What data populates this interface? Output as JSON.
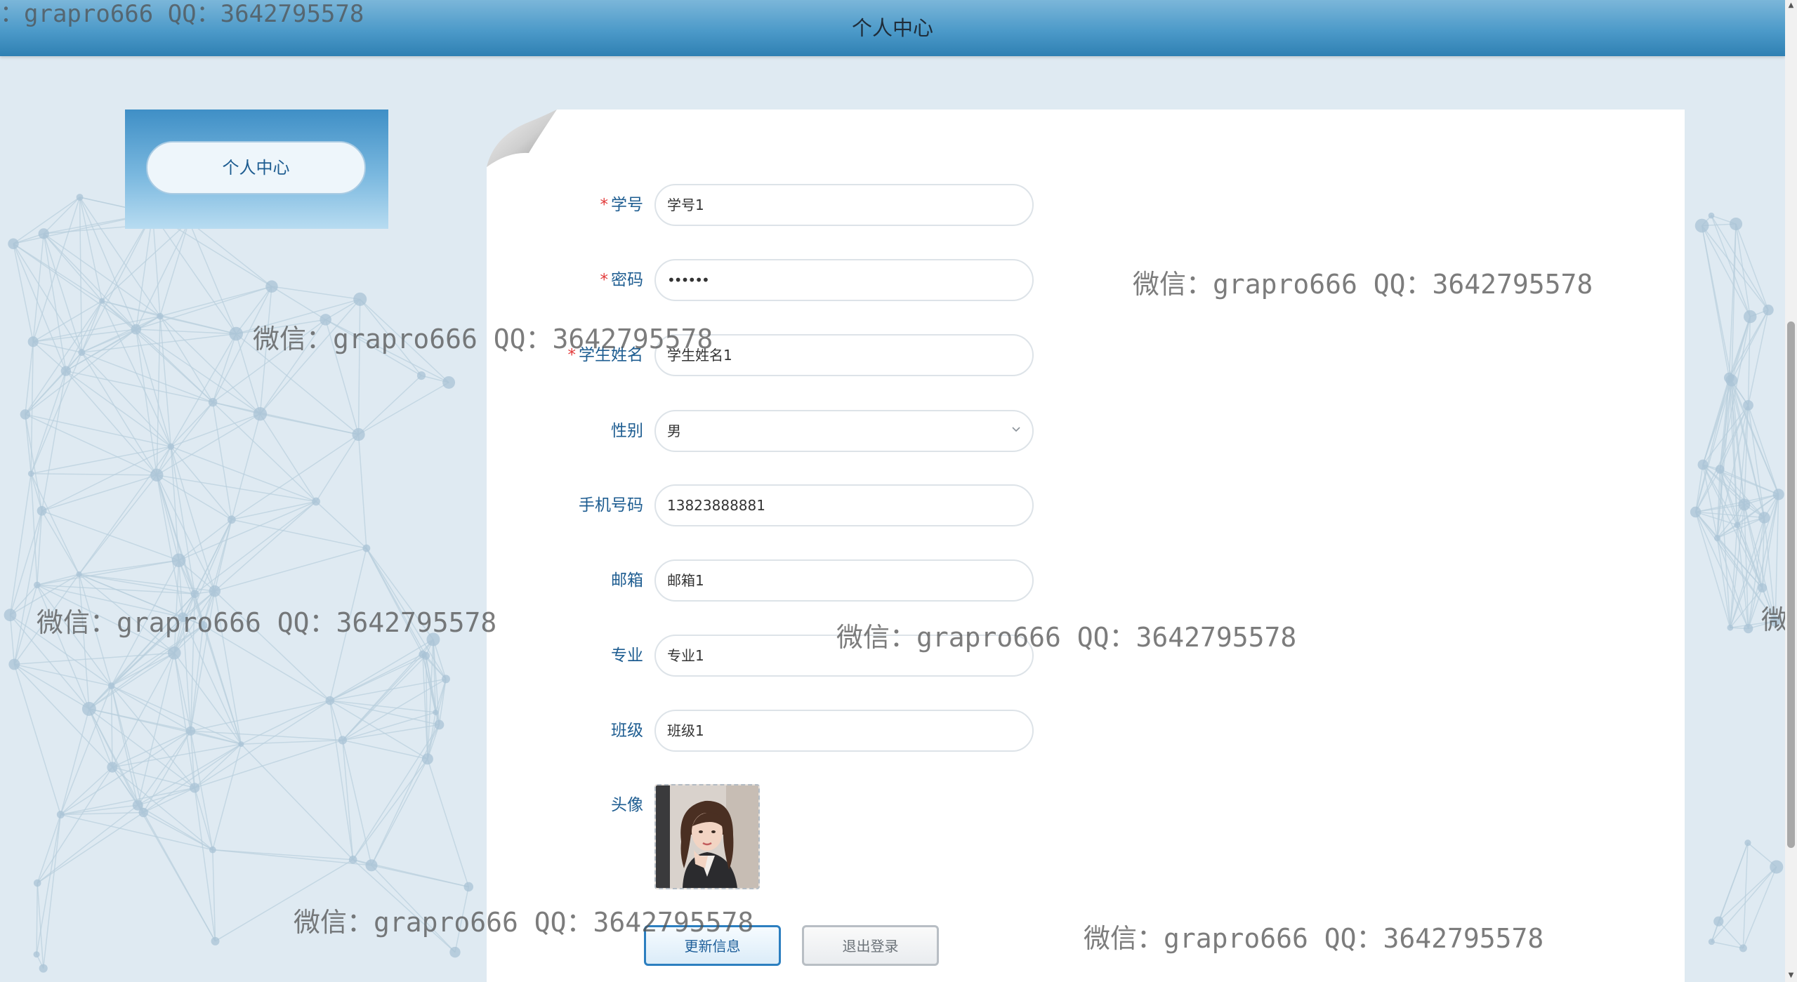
{
  "header": {
    "title": "个人中心"
  },
  "sidebar": {
    "button_label": "个人中心"
  },
  "form": {
    "fields": [
      {
        "label": "学号",
        "required": true,
        "value": "学号1"
      },
      {
        "label": "密码",
        "required": true,
        "value": "••••••"
      },
      {
        "label": "学生姓名",
        "required": true,
        "value": "学生姓名1"
      },
      {
        "label": "性别",
        "required": false,
        "value": "男"
      },
      {
        "label": "手机号码",
        "required": false,
        "value": "13823888881"
      },
      {
        "label": "邮箱",
        "required": false,
        "value": "邮箱1"
      },
      {
        "label": "专业",
        "required": false,
        "value": "专业1"
      },
      {
        "label": "班级",
        "required": false,
        "value": "班级1"
      },
      {
        "label": "头像",
        "required": false
      }
    ],
    "required_mark": "*"
  },
  "buttons": {
    "update": "更新信息",
    "logout": "退出登录"
  },
  "watermark_text": "微信：grapro666 QQ：3642795578",
  "watermark_top_left": "：grapro666 QQ：3642795578",
  "watermark_edge_right": "微信",
  "colors": {
    "accent": "#1e5d91",
    "required": "#e23a3a",
    "header": "#4c9ac9"
  },
  "icons": {
    "select_chevron": "chevron-down-icon",
    "card_corner": "page-curl-icon"
  }
}
